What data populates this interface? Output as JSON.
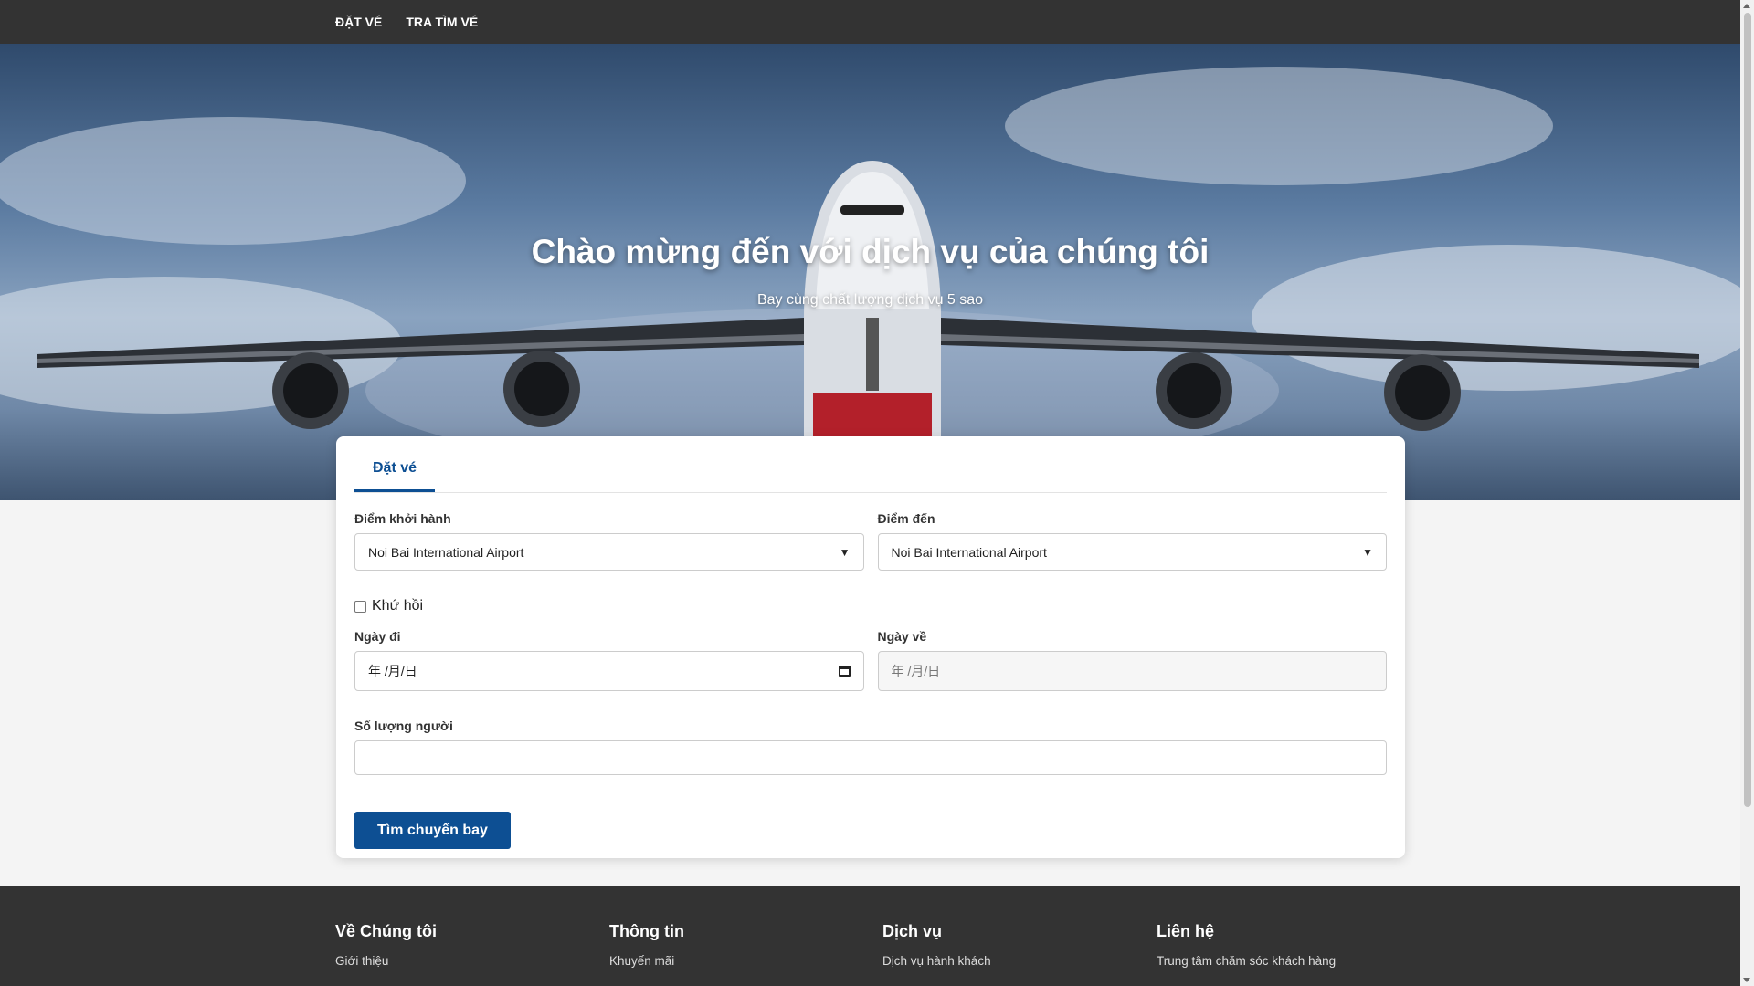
{
  "nav": {
    "items": [
      "ĐẶT VÉ",
      "TRA TÌM VÉ"
    ]
  },
  "hero": {
    "title": "Chào mừng đến với dịch vụ của chúng tôi",
    "subtitle": "Bay cùng chất lượng dịch vụ 5 sao"
  },
  "form": {
    "tab_label": "Đặt vé",
    "origin_label": "Điểm khởi hành",
    "origin_value": "Noi Bai International Airport",
    "dest_label": "Điểm đến",
    "dest_value": "Noi Bai International Airport",
    "roundtrip_label": "Khứ hồi",
    "depart_label": "Ngày đi",
    "depart_placeholder": "年 /月/日",
    "return_label": "Ngày về",
    "return_placeholder": "年 /月/日",
    "passengers_label": "Số lượng người",
    "passengers_value": "",
    "submit_label": "Tìm chuyến bay"
  },
  "footer": {
    "columns": [
      {
        "title": "Về Chúng tôi",
        "link": "Giới thiệu"
      },
      {
        "title": "Thông tin",
        "link": "Khuyến mãi"
      },
      {
        "title": "Dịch vụ",
        "link": "Dịch vụ hành khách"
      },
      {
        "title": "Liên hệ",
        "link": "Trung tâm chăm sóc khách hàng"
      }
    ]
  }
}
